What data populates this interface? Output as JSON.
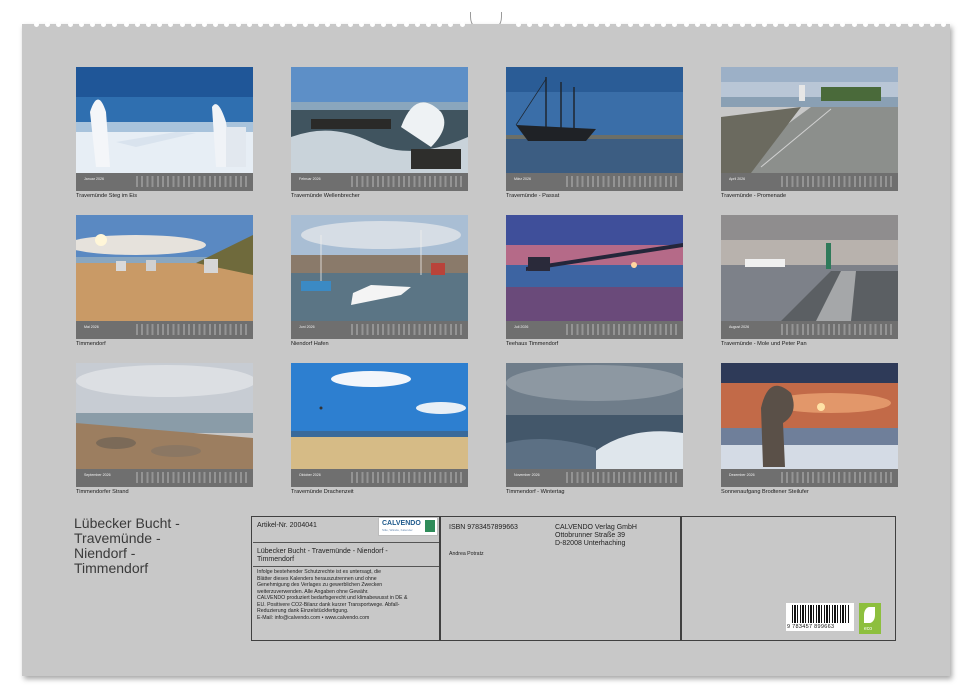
{
  "calendar": {
    "title_lines": [
      "Lübecker Bucht -",
      "Travemünde -",
      "Niendorf -",
      "Timmendorf"
    ],
    "months": [
      {
        "name": "Januar 2026",
        "caption": "Travemünde Steg im Eis"
      },
      {
        "name": "Februar 2026",
        "caption": "Travemünde Wellenbrecher"
      },
      {
        "name": "März 2026",
        "caption": "Travemünde - Passat"
      },
      {
        "name": "April 2026",
        "caption": "Travemünde - Promenade"
      },
      {
        "name": "Mai 2026",
        "caption": "Timmendorf"
      },
      {
        "name": "Juni 2026",
        "caption": "Niendorf Hafen"
      },
      {
        "name": "Juli 2026",
        "caption": "Teehaus Timmendorf"
      },
      {
        "name": "August 2026",
        "caption": "Travemünde - Mole und Peter Pan"
      },
      {
        "name": "September 2026",
        "caption": "Timmendorfer Strand"
      },
      {
        "name": "Oktober 2026",
        "caption": "Travemünde Drachenzeit"
      },
      {
        "name": "November 2026",
        "caption": "Timmendorf - Wintertag"
      },
      {
        "name": "Dezember 2026",
        "caption": "Sonnenaufgang Brodtener Steilufer"
      }
    ]
  },
  "info": {
    "article": "Artikel-Nr. 2004041",
    "logo_text": "CALVENDO",
    "logo_sub": "Stile, Wände, Kalender",
    "product_title_lines": [
      "Lübecker Bucht - Travemünde - Niendorf -",
      "Timmendorf"
    ],
    "legal_lines": [
      "Infolge bestehender Schutzrechte ist es untersagt, die",
      "Blätter dieses Kalenders herauszutrennen und ohne",
      "Genehmigung des Verlages zu gewerblichen Zwecken",
      "weiterzuverwenden. Alle Angaben ohne Gewähr.",
      "CALVENDO produziert bedarfsgerecht und klimabewusst in DE &",
      "EU. Positivere CO2-Bilanz dank kurzer Transportwege. Abfall-",
      "Reduzierung dank Einzelstückfertigung.",
      "E-Mail: info@calvendo.com • www.calvendo.com"
    ],
    "isbn": "ISBN 9783457899663",
    "author": "Andrea Potratz",
    "publisher_lines": [
      "CALVENDO Verlag GmbH",
      "Ottobrunner Straße 39",
      "D-82008 Unterhaching"
    ],
    "barcode_number": "9 783457 899663",
    "eco_label": "eco"
  }
}
